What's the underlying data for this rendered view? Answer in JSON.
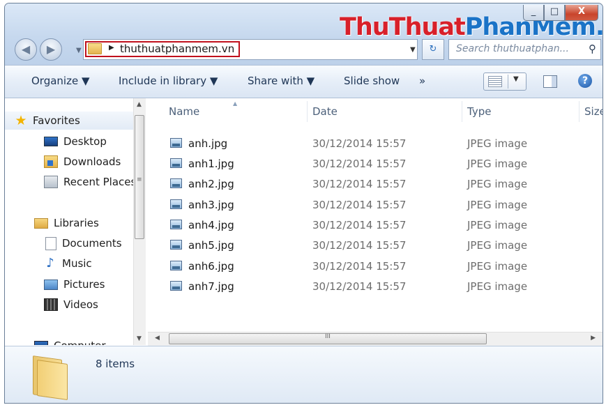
{
  "window": {
    "controls": {
      "minimize": "_",
      "maximize": "□",
      "close": "X"
    },
    "watermark": {
      "part1": "ThuThuat",
      "part2": "PhanMem.vn"
    }
  },
  "nav": {
    "back": "◀",
    "forward": "▶",
    "history": "▼"
  },
  "address": {
    "arrow": "▶",
    "path": "thuthuatphanmem.vn",
    "dropdown": "▼"
  },
  "refresh": "↻",
  "search": {
    "placeholder": "Search thuthuatphan...",
    "icon": "⚲"
  },
  "toolbar": {
    "organize": "Organize ▼",
    "include": "Include in library ▼",
    "share": "Share with ▼",
    "slideshow": "Slide show",
    "more": "»",
    "view_drop": "▼",
    "help": "?"
  },
  "sidebar": {
    "favorites": {
      "label": "Favorites",
      "icon": "★"
    },
    "favorite_items": [
      "Desktop",
      "Downloads",
      "Recent Places"
    ],
    "libraries": "Libraries",
    "library_items": [
      "Documents",
      "Music",
      "Pictures",
      "Videos"
    ],
    "music_icon": "♪",
    "computer": "Computer"
  },
  "scrollbars": {
    "up": "▲",
    "down": "▼",
    "left": "◀",
    "right": "▶",
    "grip_v": "≡",
    "grip_h": "III"
  },
  "columns": {
    "name": "Name",
    "sort": "▲",
    "date": "Date",
    "type": "Type",
    "size": "Size"
  },
  "files": [
    {
      "name": "anh.jpg",
      "date": "30/12/2014 15:57",
      "type": "JPEG image"
    },
    {
      "name": "anh1.jpg",
      "date": "30/12/2014 15:57",
      "type": "JPEG image"
    },
    {
      "name": "anh2.jpg",
      "date": "30/12/2014 15:57",
      "type": "JPEG image"
    },
    {
      "name": "anh3.jpg",
      "date": "30/12/2014 15:57",
      "type": "JPEG image"
    },
    {
      "name": "anh4.jpg",
      "date": "30/12/2014 15:57",
      "type": "JPEG image"
    },
    {
      "name": "anh5.jpg",
      "date": "30/12/2014 15:57",
      "type": "JPEG image"
    },
    {
      "name": "anh6.jpg",
      "date": "30/12/2014 15:57",
      "type": "JPEG image"
    },
    {
      "name": "anh7.jpg",
      "date": "30/12/2014 15:57",
      "type": "JPEG image"
    }
  ],
  "status": {
    "count": "8 items"
  },
  "colors": {
    "highlight_box": "#c0101c",
    "watermark_red": "#d8202a",
    "watermark_blue": "#1a73c7"
  }
}
